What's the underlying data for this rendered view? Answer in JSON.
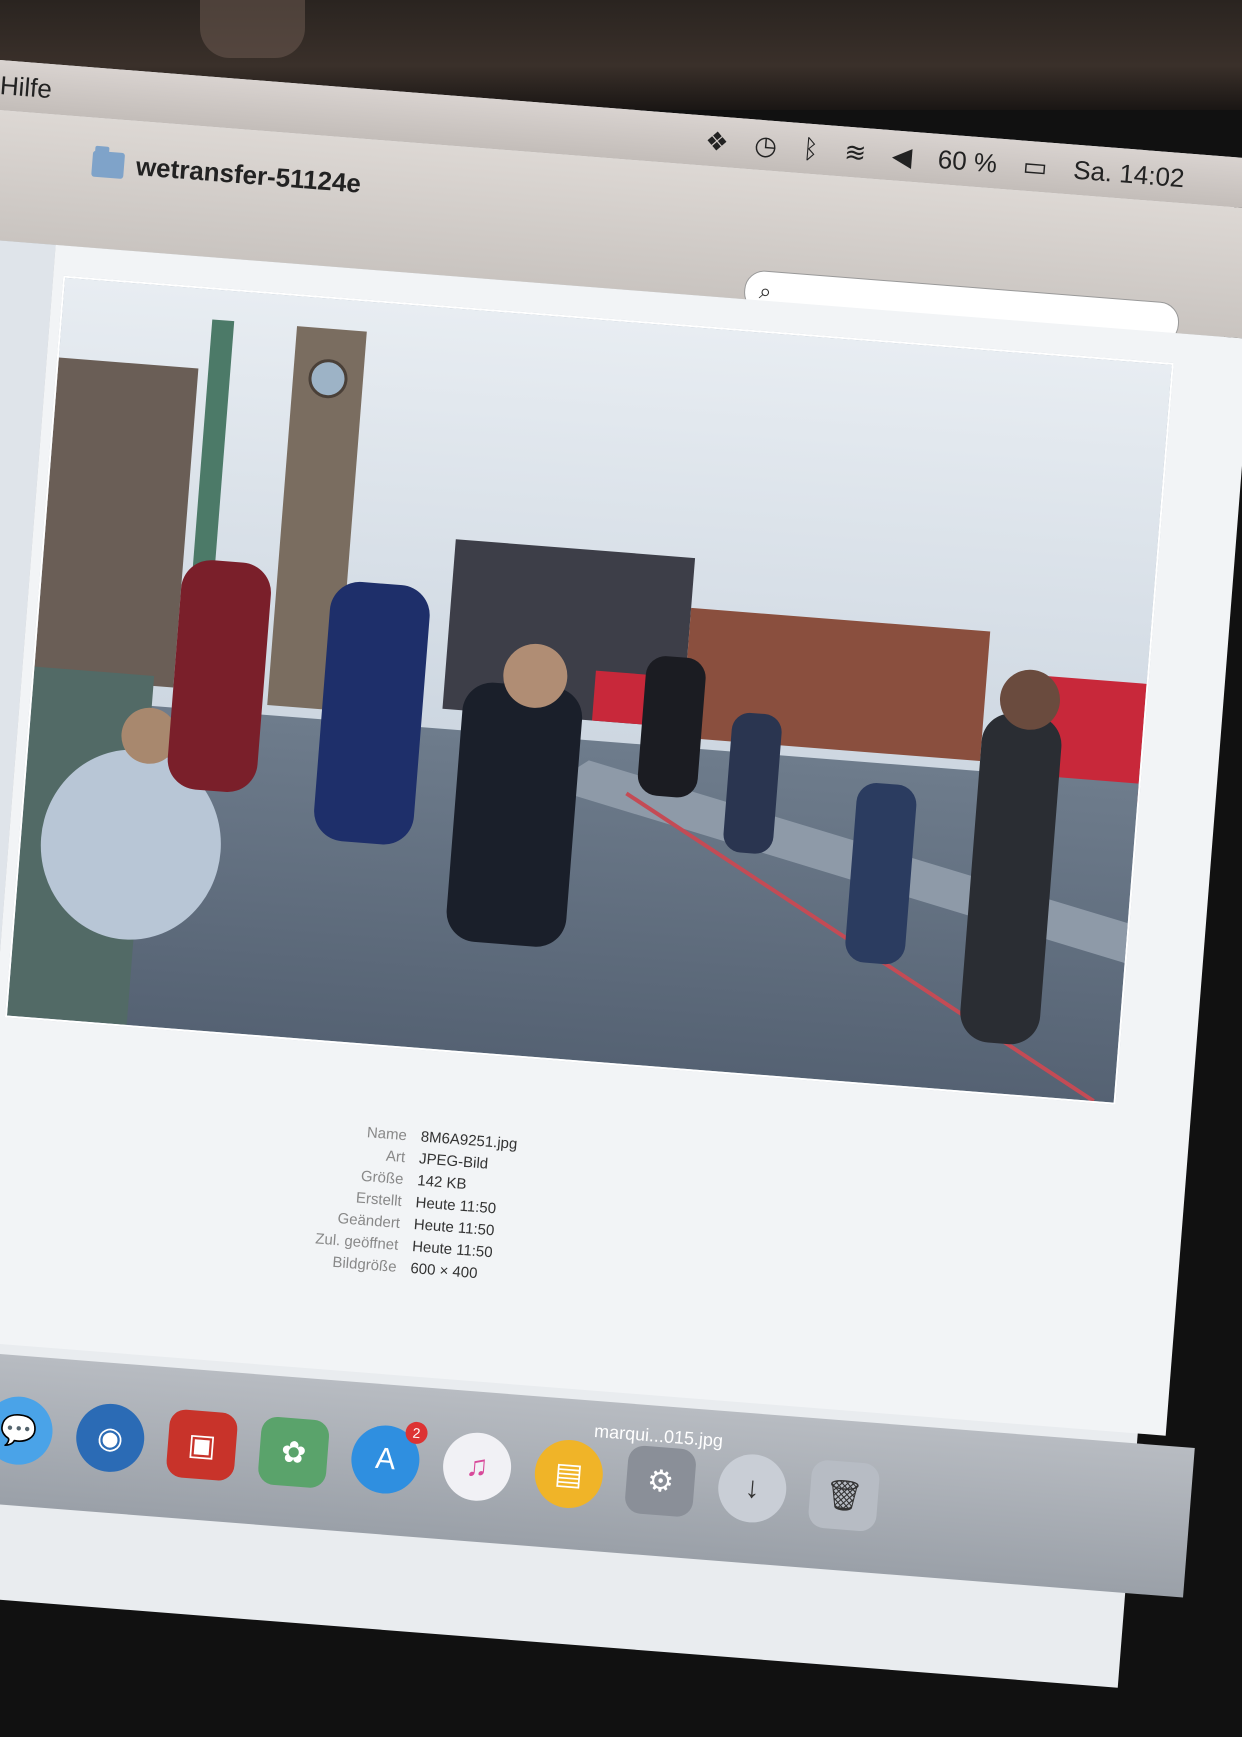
{
  "menubar": {
    "help_label": "Hilfe",
    "battery_text": "60 %",
    "clock": "Sa. 14:02",
    "status_icons": [
      "dropbox-icon",
      "time-machine-icon",
      "bluetooth-icon",
      "wifi-icon",
      "volume-icon",
      "battery-icon"
    ]
  },
  "window": {
    "title": "wetransfer-51124e",
    "search": {
      "placeholder": ""
    }
  },
  "file_info": [
    {
      "key": "Name",
      "value": "8M6A9251.jpg"
    },
    {
      "key": "Art",
      "value": "JPEG-Bild"
    },
    {
      "key": "Größe",
      "value": "142 KB"
    },
    {
      "key": "Erstellt",
      "value": "Heute 11:50"
    },
    {
      "key": "Geändert",
      "value": "Heute 11:50"
    },
    {
      "key": "Zul. geöffnet",
      "value": "Heute 11:50"
    },
    {
      "key": "Bildgröße",
      "value": "600 × 400"
    }
  ],
  "dock": {
    "label": "marqui...015.jpg",
    "items": [
      "preview-icon",
      "messages-icon",
      "safari-icon",
      "photo-booth-icon",
      "iphoto-icon",
      "app-store-icon",
      "itunes-icon",
      "ibooks-icon",
      "system-preferences-icon",
      "downloads-icon",
      "trash-icon"
    ],
    "app_store_badge": "2"
  },
  "colors": {
    "menubar": "#d9d3d0",
    "sky": "#c7d3de",
    "road": "#5f6f82"
  }
}
